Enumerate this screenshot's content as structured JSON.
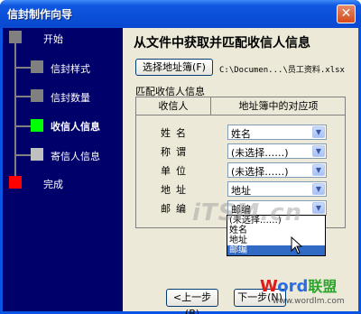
{
  "window": {
    "title": "信封制作向导",
    "close_glyph": "✕"
  },
  "sidebar": {
    "steps": [
      {
        "label": "开始",
        "color": "#808080"
      },
      {
        "label": "信封样式",
        "color": "#808080"
      },
      {
        "label": "信封数量",
        "color": "#808080"
      },
      {
        "label": "收信人信息",
        "color": "#00ff00",
        "active": true
      },
      {
        "label": "寄信人信息",
        "color": "#c0c0c0"
      },
      {
        "label": "完成",
        "color": "#ff0000"
      }
    ]
  },
  "main": {
    "heading": "从文件中获取并匹配收信人信息",
    "select_button": "选择地址簿(F)",
    "file_path": "C:\\Documen...\\员工资料.xlsx",
    "group_label": "匹配收信人信息",
    "headers": {
      "recipient": "收信人",
      "address_book_field": "地址簿中的对应项"
    },
    "rows": [
      {
        "label": "姓名",
        "value": "姓名"
      },
      {
        "label": "称谓",
        "value": "(未选择……)"
      },
      {
        "label": "单位",
        "value": "(未选择……)"
      },
      {
        "label": "地址",
        "value": "地址"
      },
      {
        "label": "邮编",
        "value": "邮编"
      }
    ],
    "dropdown_options": [
      "(未选择……)",
      "姓名",
      "地址",
      "邮编"
    ],
    "dropdown_selected": 3
  },
  "footer": {
    "back_button": "<上一步(B)",
    "next_button": "下一步(N)"
  },
  "overlay": {
    "watermark": "iTSM.cn",
    "logo_w": "W",
    "logo_ord": "ord",
    "logo_cn": "联盟",
    "url": "www.wordlm.com"
  }
}
